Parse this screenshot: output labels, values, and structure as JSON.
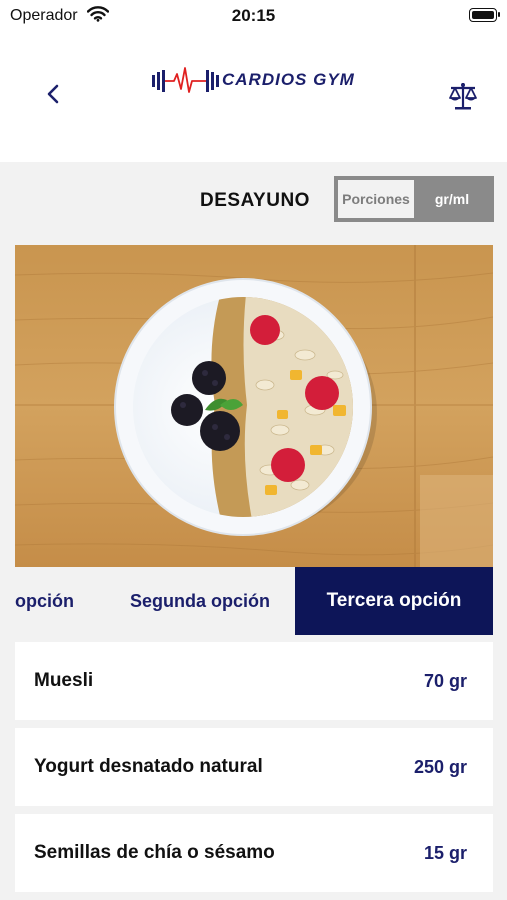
{
  "status_bar": {
    "carrier": "Operador",
    "time": "20:15"
  },
  "navbar": {
    "brand": "CARDIOS GYM",
    "back_icon": "chevron-left-icon",
    "scale_icon": "balance-scale-icon"
  },
  "meal": {
    "title": "DESAYUNO"
  },
  "unit_toggle": {
    "options": [
      "Porciones",
      "gr/ml"
    ],
    "selected": "gr/ml"
  },
  "tabs": [
    {
      "label": "opción"
    },
    {
      "label": "Segunda opción"
    },
    {
      "label": "Tercera opción",
      "active": true
    }
  ],
  "ingredients": [
    {
      "name": "Muesli",
      "qty": "70 gr"
    },
    {
      "name": "Yogurt desnatado natural",
      "qty": "250 gr"
    },
    {
      "name": "Semillas de chía o sésamo",
      "qty": "15 gr"
    }
  ],
  "colors": {
    "brand_navy": "#0d1558",
    "text_navy": "#1b1f6b",
    "logo_red": "#e02020",
    "background": "#f2f2f2"
  }
}
